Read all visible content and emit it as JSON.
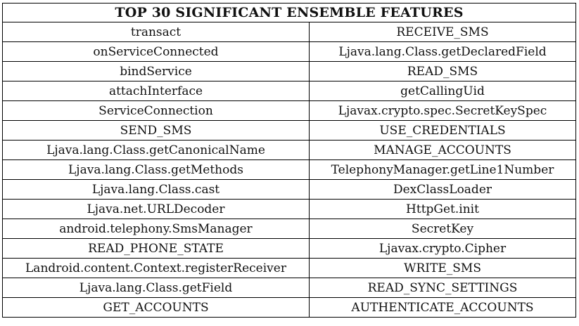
{
  "table": {
    "title": "TOP 30 SIGNIFICANT ENSEMBLE FEATURES",
    "rows": [
      [
        "transact",
        "RECEIVE_SMS"
      ],
      [
        "onServiceConnected",
        "Ljava.lang.Class.getDeclaredField"
      ],
      [
        "bindService",
        "READ_SMS"
      ],
      [
        "attachInterface",
        "getCallingUid"
      ],
      [
        "ServiceConnection",
        "Ljavax.crypto.spec.SecretKeySpec"
      ],
      [
        "SEND_SMS",
        "USE_CREDENTIALS"
      ],
      [
        "Ljava.lang.Class.getCanonicalName",
        "MANAGE_ACCOUNTS"
      ],
      [
        "Ljava.lang.Class.getMethods",
        "TelephonyManager.getLine1Number"
      ],
      [
        "Ljava.lang.Class.cast",
        "DexClassLoader"
      ],
      [
        "Ljava.net.URLDecoder",
        "HttpGet.init"
      ],
      [
        "android.telephony.SmsManager",
        "SecretKey"
      ],
      [
        "READ_PHONE_STATE",
        "Ljavax.crypto.Cipher"
      ],
      [
        "Landroid.content.Context.registerReceiver",
        "WRITE_SMS"
      ],
      [
        "Ljava.lang.Class.getField",
        "READ_SYNC_SETTINGS"
      ],
      [
        "GET_ACCOUNTS",
        "AUTHENTICATE_ACCOUNTS"
      ]
    ]
  }
}
